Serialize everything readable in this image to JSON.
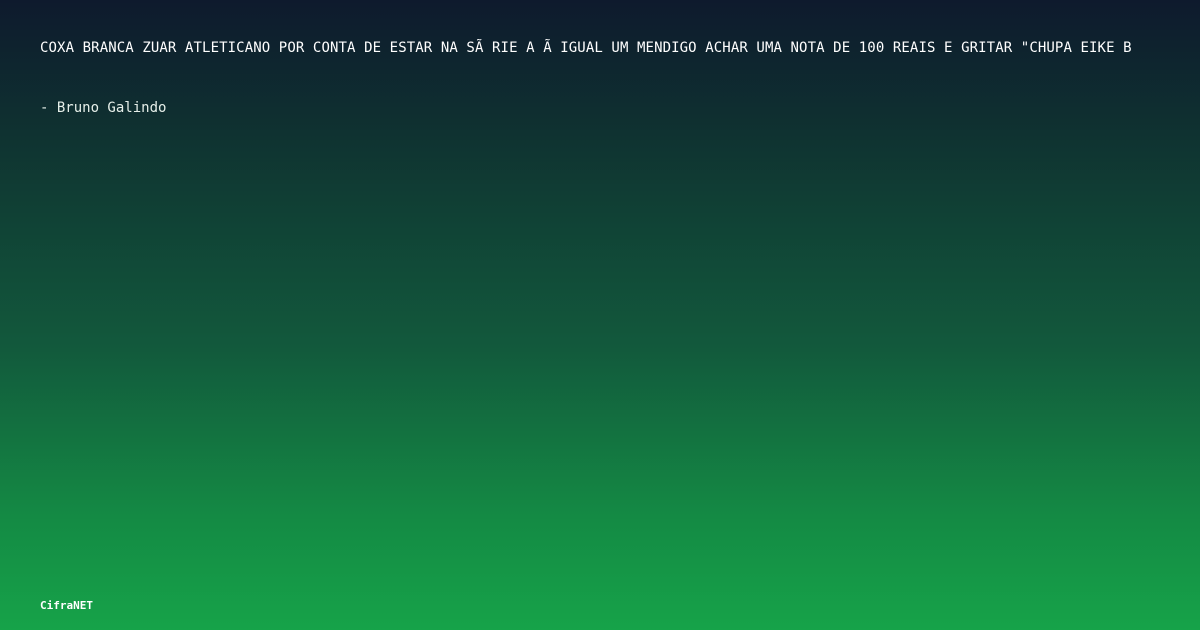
{
  "quote": {
    "text": "COXA BRANCA ZUAR ATLETICANO POR CONTA DE ESTAR NA SÃ RIE A Ã  IGUAL UM MENDIGO ACHAR UMA NOTA DE 100 REAIS E GRITAR \"CHUPA EIKE B"
  },
  "author": {
    "text": "- Bruno Galindo"
  },
  "brand": {
    "name": "CifraNET"
  }
}
